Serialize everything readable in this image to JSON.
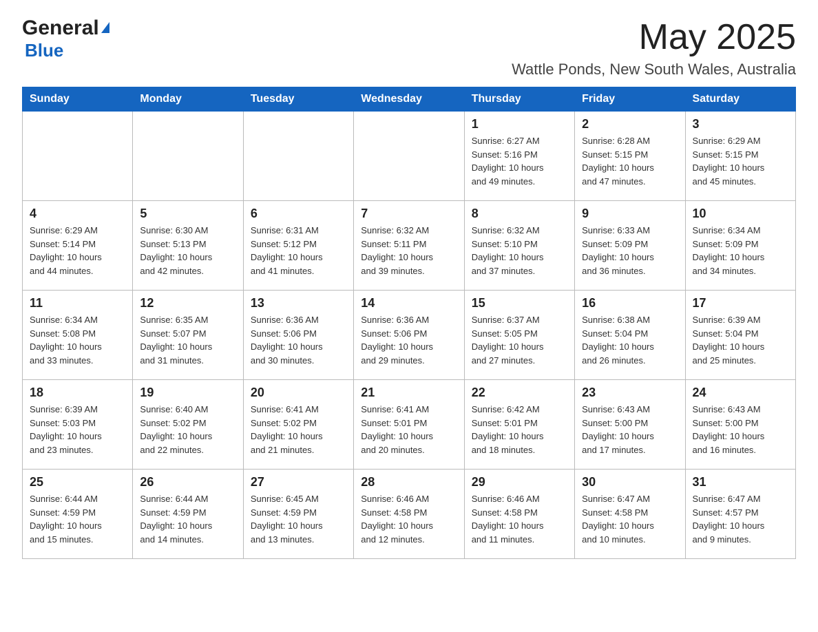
{
  "header": {
    "logo_general": "General",
    "logo_blue": "Blue",
    "month_year": "May 2025",
    "location": "Wattle Ponds, New South Wales, Australia"
  },
  "days_of_week": [
    "Sunday",
    "Monday",
    "Tuesday",
    "Wednesday",
    "Thursday",
    "Friday",
    "Saturday"
  ],
  "weeks": [
    [
      {
        "day": "",
        "info": ""
      },
      {
        "day": "",
        "info": ""
      },
      {
        "day": "",
        "info": ""
      },
      {
        "day": "",
        "info": ""
      },
      {
        "day": "1",
        "info": "Sunrise: 6:27 AM\nSunset: 5:16 PM\nDaylight: 10 hours\nand 49 minutes."
      },
      {
        "day": "2",
        "info": "Sunrise: 6:28 AM\nSunset: 5:15 PM\nDaylight: 10 hours\nand 47 minutes."
      },
      {
        "day": "3",
        "info": "Sunrise: 6:29 AM\nSunset: 5:15 PM\nDaylight: 10 hours\nand 45 minutes."
      }
    ],
    [
      {
        "day": "4",
        "info": "Sunrise: 6:29 AM\nSunset: 5:14 PM\nDaylight: 10 hours\nand 44 minutes."
      },
      {
        "day": "5",
        "info": "Sunrise: 6:30 AM\nSunset: 5:13 PM\nDaylight: 10 hours\nand 42 minutes."
      },
      {
        "day": "6",
        "info": "Sunrise: 6:31 AM\nSunset: 5:12 PM\nDaylight: 10 hours\nand 41 minutes."
      },
      {
        "day": "7",
        "info": "Sunrise: 6:32 AM\nSunset: 5:11 PM\nDaylight: 10 hours\nand 39 minutes."
      },
      {
        "day": "8",
        "info": "Sunrise: 6:32 AM\nSunset: 5:10 PM\nDaylight: 10 hours\nand 37 minutes."
      },
      {
        "day": "9",
        "info": "Sunrise: 6:33 AM\nSunset: 5:09 PM\nDaylight: 10 hours\nand 36 minutes."
      },
      {
        "day": "10",
        "info": "Sunrise: 6:34 AM\nSunset: 5:09 PM\nDaylight: 10 hours\nand 34 minutes."
      }
    ],
    [
      {
        "day": "11",
        "info": "Sunrise: 6:34 AM\nSunset: 5:08 PM\nDaylight: 10 hours\nand 33 minutes."
      },
      {
        "day": "12",
        "info": "Sunrise: 6:35 AM\nSunset: 5:07 PM\nDaylight: 10 hours\nand 31 minutes."
      },
      {
        "day": "13",
        "info": "Sunrise: 6:36 AM\nSunset: 5:06 PM\nDaylight: 10 hours\nand 30 minutes."
      },
      {
        "day": "14",
        "info": "Sunrise: 6:36 AM\nSunset: 5:06 PM\nDaylight: 10 hours\nand 29 minutes."
      },
      {
        "day": "15",
        "info": "Sunrise: 6:37 AM\nSunset: 5:05 PM\nDaylight: 10 hours\nand 27 minutes."
      },
      {
        "day": "16",
        "info": "Sunrise: 6:38 AM\nSunset: 5:04 PM\nDaylight: 10 hours\nand 26 minutes."
      },
      {
        "day": "17",
        "info": "Sunrise: 6:39 AM\nSunset: 5:04 PM\nDaylight: 10 hours\nand 25 minutes."
      }
    ],
    [
      {
        "day": "18",
        "info": "Sunrise: 6:39 AM\nSunset: 5:03 PM\nDaylight: 10 hours\nand 23 minutes."
      },
      {
        "day": "19",
        "info": "Sunrise: 6:40 AM\nSunset: 5:02 PM\nDaylight: 10 hours\nand 22 minutes."
      },
      {
        "day": "20",
        "info": "Sunrise: 6:41 AM\nSunset: 5:02 PM\nDaylight: 10 hours\nand 21 minutes."
      },
      {
        "day": "21",
        "info": "Sunrise: 6:41 AM\nSunset: 5:01 PM\nDaylight: 10 hours\nand 20 minutes."
      },
      {
        "day": "22",
        "info": "Sunrise: 6:42 AM\nSunset: 5:01 PM\nDaylight: 10 hours\nand 18 minutes."
      },
      {
        "day": "23",
        "info": "Sunrise: 6:43 AM\nSunset: 5:00 PM\nDaylight: 10 hours\nand 17 minutes."
      },
      {
        "day": "24",
        "info": "Sunrise: 6:43 AM\nSunset: 5:00 PM\nDaylight: 10 hours\nand 16 minutes."
      }
    ],
    [
      {
        "day": "25",
        "info": "Sunrise: 6:44 AM\nSunset: 4:59 PM\nDaylight: 10 hours\nand 15 minutes."
      },
      {
        "day": "26",
        "info": "Sunrise: 6:44 AM\nSunset: 4:59 PM\nDaylight: 10 hours\nand 14 minutes."
      },
      {
        "day": "27",
        "info": "Sunrise: 6:45 AM\nSunset: 4:59 PM\nDaylight: 10 hours\nand 13 minutes."
      },
      {
        "day": "28",
        "info": "Sunrise: 6:46 AM\nSunset: 4:58 PM\nDaylight: 10 hours\nand 12 minutes."
      },
      {
        "day": "29",
        "info": "Sunrise: 6:46 AM\nSunset: 4:58 PM\nDaylight: 10 hours\nand 11 minutes."
      },
      {
        "day": "30",
        "info": "Sunrise: 6:47 AM\nSunset: 4:58 PM\nDaylight: 10 hours\nand 10 minutes."
      },
      {
        "day": "31",
        "info": "Sunrise: 6:47 AM\nSunset: 4:57 PM\nDaylight: 10 hours\nand 9 minutes."
      }
    ]
  ]
}
